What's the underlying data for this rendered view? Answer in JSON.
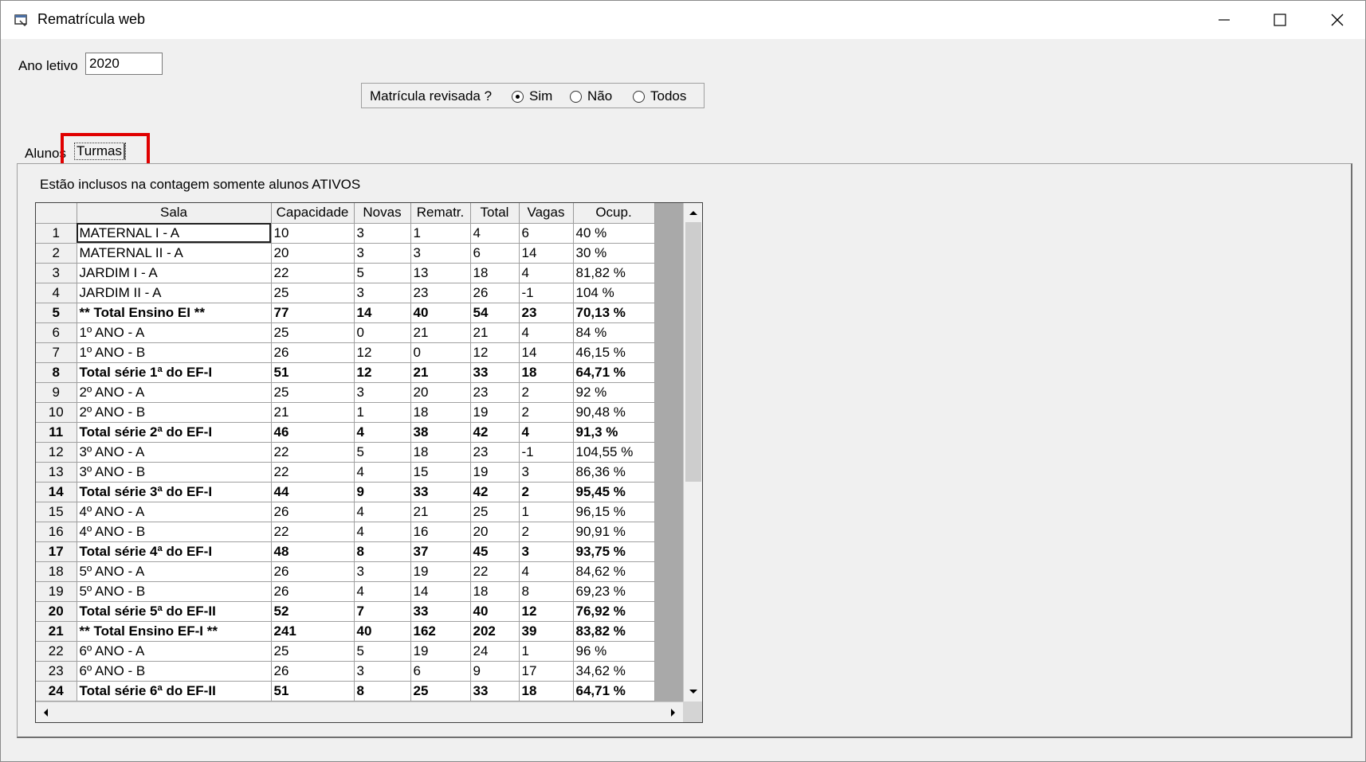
{
  "window": {
    "title": "Rematrícula web",
    "icon": "app-window-icon",
    "controls": [
      "minimize-icon",
      "maximize-icon",
      "close-icon"
    ]
  },
  "form": {
    "ano_label": "Ano letivo",
    "ano_value": "2020",
    "matricula_label": "Matrícula revisada ?",
    "options": [
      "Sim",
      "Não",
      "Todos"
    ],
    "selected": "Sim"
  },
  "tabs": {
    "alunos": "Alunos",
    "turmas": "Turmas",
    "active": "Turmas"
  },
  "note": "Estão inclusos na contagem somente alunos ATIVOS",
  "table": {
    "headers": [
      "Sala",
      "Capacidade",
      "Novas",
      "Rematr.",
      "Total",
      "Vagas",
      "Ocup."
    ],
    "rows": [
      {
        "n": "1",
        "bold": false,
        "c": [
          "MATERNAL I - A",
          "10",
          "3",
          "1",
          "4",
          "6",
          "40 %"
        ]
      },
      {
        "n": "2",
        "bold": false,
        "c": [
          "MATERNAL II - A",
          "20",
          "3",
          "3",
          "6",
          "14",
          "30 %"
        ]
      },
      {
        "n": "3",
        "bold": false,
        "c": [
          "JARDIM I - A",
          "22",
          "5",
          "13",
          "18",
          "4",
          "81,82 %"
        ]
      },
      {
        "n": "4",
        "bold": false,
        "c": [
          "JARDIM II - A",
          "25",
          "3",
          "23",
          "26",
          "-1",
          "104 %"
        ]
      },
      {
        "n": "5",
        "bold": true,
        "c": [
          "** Total Ensino EI **",
          "77",
          "14",
          "40",
          "54",
          "23",
          "70,13 %"
        ]
      },
      {
        "n": "6",
        "bold": false,
        "c": [
          "1º ANO - A",
          "25",
          "0",
          "21",
          "21",
          "4",
          "84 %"
        ]
      },
      {
        "n": "7",
        "bold": false,
        "c": [
          "1º ANO - B",
          "26",
          "12",
          "0",
          "12",
          "14",
          "46,15 %"
        ]
      },
      {
        "n": "8",
        "bold": true,
        "c": [
          "Total série 1ª do EF-I",
          "51",
          "12",
          "21",
          "33",
          "18",
          "64,71 %"
        ]
      },
      {
        "n": "9",
        "bold": false,
        "c": [
          "2º ANO - A",
          "25",
          "3",
          "20",
          "23",
          "2",
          "92 %"
        ]
      },
      {
        "n": "10",
        "bold": false,
        "c": [
          "2º ANO - B",
          "21",
          "1",
          "18",
          "19",
          "2",
          "90,48 %"
        ]
      },
      {
        "n": "11",
        "bold": true,
        "c": [
          "Total série 2ª do EF-I",
          "46",
          "4",
          "38",
          "42",
          "4",
          "91,3 %"
        ]
      },
      {
        "n": "12",
        "bold": false,
        "c": [
          "3º ANO - A",
          "22",
          "5",
          "18",
          "23",
          "-1",
          "104,55 %"
        ]
      },
      {
        "n": "13",
        "bold": false,
        "c": [
          "3º ANO - B",
          "22",
          "4",
          "15",
          "19",
          "3",
          "86,36 %"
        ]
      },
      {
        "n": "14",
        "bold": true,
        "c": [
          "Total série 3ª do EF-I",
          "44",
          "9",
          "33",
          "42",
          "2",
          "95,45 %"
        ]
      },
      {
        "n": "15",
        "bold": false,
        "c": [
          "4º ANO - A",
          "26",
          "4",
          "21",
          "25",
          "1",
          "96,15 %"
        ]
      },
      {
        "n": "16",
        "bold": false,
        "c": [
          "4º ANO - B",
          "22",
          "4",
          "16",
          "20",
          "2",
          "90,91 %"
        ]
      },
      {
        "n": "17",
        "bold": true,
        "c": [
          "Total série 4ª do EF-I",
          "48",
          "8",
          "37",
          "45",
          "3",
          "93,75 %"
        ]
      },
      {
        "n": "18",
        "bold": false,
        "c": [
          "5º ANO - A",
          "26",
          "3",
          "19",
          "22",
          "4",
          "84,62 %"
        ]
      },
      {
        "n": "19",
        "bold": false,
        "c": [
          "5º ANO - B",
          "26",
          "4",
          "14",
          "18",
          "8",
          "69,23 %"
        ]
      },
      {
        "n": "20",
        "bold": true,
        "c": [
          "Total série 5ª do EF-II",
          "52",
          "7",
          "33",
          "40",
          "12",
          "76,92 %"
        ]
      },
      {
        "n": "21",
        "bold": true,
        "c": [
          "** Total Ensino EF-I **",
          "241",
          "40",
          "162",
          "202",
          "39",
          "83,82 %"
        ]
      },
      {
        "n": "22",
        "bold": false,
        "c": [
          "6º ANO - A",
          "25",
          "5",
          "19",
          "24",
          "1",
          "96 %"
        ]
      },
      {
        "n": "23",
        "bold": false,
        "c": [
          "6º ANO - B",
          "26",
          "3",
          "6",
          "9",
          "17",
          "34,62 %"
        ]
      },
      {
        "n": "24",
        "bold": true,
        "c": [
          "Total série 6ª do EF-II",
          "51",
          "8",
          "25",
          "33",
          "18",
          "64,71 %"
        ]
      }
    ]
  }
}
